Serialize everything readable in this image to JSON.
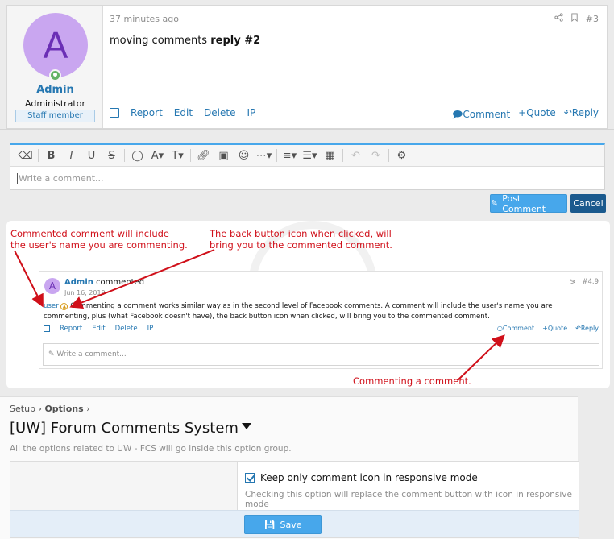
{
  "post": {
    "time": "37 minutes ago",
    "number": "#3",
    "body_text": "moving comments ",
    "body_bold": "reply #2",
    "user": {
      "initial": "A",
      "name": "Admin",
      "title": "Administrator",
      "banner": "Staff member"
    },
    "actions_left": [
      "Report",
      "Edit",
      "Delete",
      "IP"
    ],
    "actions_right": {
      "comment": "Comment",
      "quote": "Quote",
      "reply": "Reply"
    }
  },
  "editor": {
    "placeholder": "Write a comment...",
    "post_button": "Post Comment",
    "cancel_button": "Cancel"
  },
  "annotations": {
    "note1_line1": "Commented comment will include",
    "note1_line2": "the user's name you are commenting.",
    "note2_line1": "The back button icon when clicked, will",
    "note2_line2": "bring you to the commented comment.",
    "note3": "Commenting a comment."
  },
  "example_comment": {
    "initial": "A",
    "name": "Admin",
    "verb": "commented",
    "date": "Jun 16, 2019",
    "number": "#4.9",
    "mention": "user",
    "text": " Commenting a comment works similar way as in the second level of Facebook comments. A comment will include the user's name you are commenting, plus (what Facebook doesn't have), the back button icon when clicked, will bring you to the commented comment.",
    "actions_left": [
      "Report",
      "Edit",
      "Delete",
      "IP"
    ],
    "actions_right": {
      "comment": "Comment",
      "quote": "Quote",
      "reply": "Reply"
    },
    "placeholder": "Write a comment..."
  },
  "options_page": {
    "crumb1": "Setup",
    "crumb2": "Options",
    "title": "[UW] Forum Comments System",
    "description": "All the options related to UW - FCS will go inside this option group.",
    "option_label": "Keep only comment icon in responsive mode",
    "option_hint": "Checking this option will replace the comment button with icon in responsive mode",
    "save_button": "Save"
  },
  "colors": {
    "link": "#2577b1",
    "primary_button": "#47a7eb",
    "dark_button": "#1b5a8e",
    "annotation": "#d0101a",
    "avatar_bg": "#c9a6f0"
  }
}
